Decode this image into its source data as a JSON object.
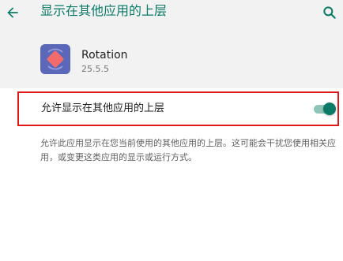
{
  "header": {
    "title": "显示在其他应用的上层",
    "back_icon": "back-arrow-icon",
    "search_icon": "search-icon",
    "icon_color": "#0a7a66"
  },
  "app": {
    "name": "Rotation",
    "version": "25.5.5",
    "icon": "rotation-app-icon",
    "icon_colors": {
      "background": "#5b67b8",
      "accent": "#f26b6b"
    }
  },
  "setting": {
    "label": "允许显示在其他应用的上层",
    "toggle_state": "on",
    "toggle_color": "#0b7a66",
    "highlight_color": "#e01818"
  },
  "description": "允许此应用显示在您当前使用的其他应用的上层。这可能会干扰您使用相关应用，或变更这类应用的显示或运行方式。"
}
